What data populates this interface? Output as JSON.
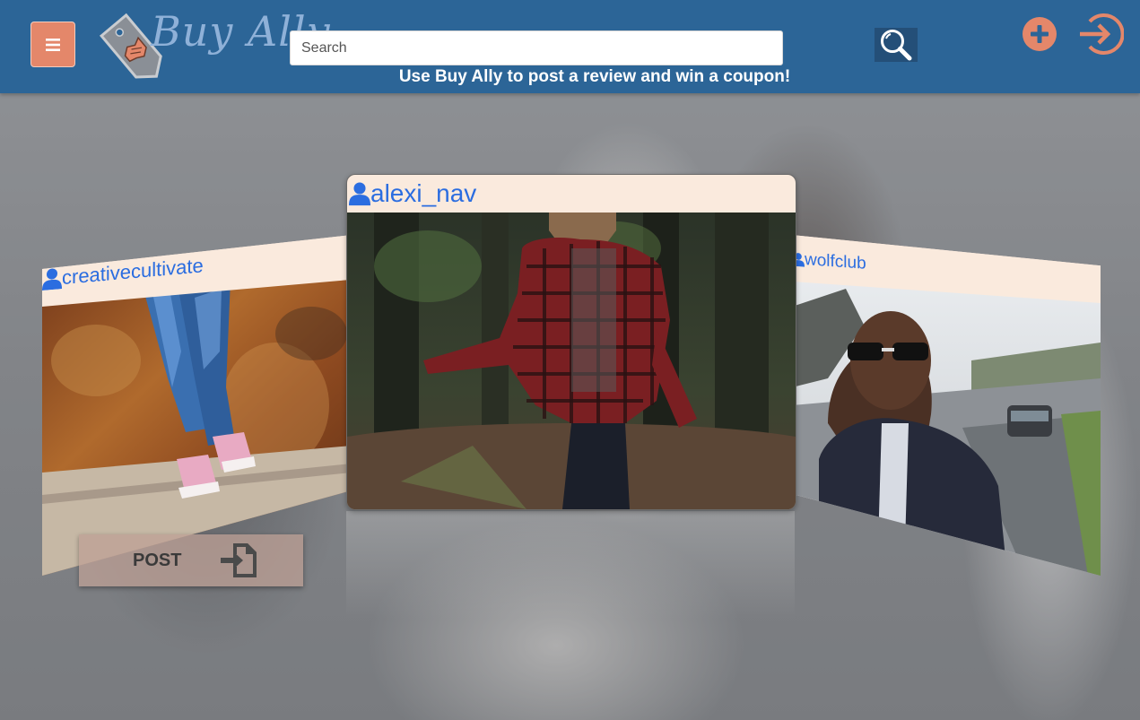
{
  "header": {
    "logo_text": "Buy Ally",
    "search": {
      "placeholder": "Search",
      "value": ""
    },
    "promo": "Use Buy Ally to post a review and win a coupon!",
    "icons": {
      "menu": "hamburger-menu-icon",
      "search": "magnifier-icon",
      "add": "plus-circle-icon",
      "login": "sign-in-icon"
    }
  },
  "carousel": {
    "cards": [
      {
        "position": "left",
        "username": "creativecultivate",
        "photo": "jeans-and-pink-sneakers"
      },
      {
        "position": "center",
        "username": "alexi_nav",
        "photo": "woman-in-plaid-shirt-in-forest"
      },
      {
        "position": "right",
        "username": "wolfclub",
        "photo": "man-in-sunglasses-by-road"
      }
    ],
    "post_button": {
      "label": "POST",
      "icon": "file-import-icon"
    }
  },
  "colors": {
    "header_bg": "#2c6597",
    "accent_orange": "#e4876a",
    "card_header_bg": "#faeadd",
    "username_blue": "#2b6de0"
  }
}
